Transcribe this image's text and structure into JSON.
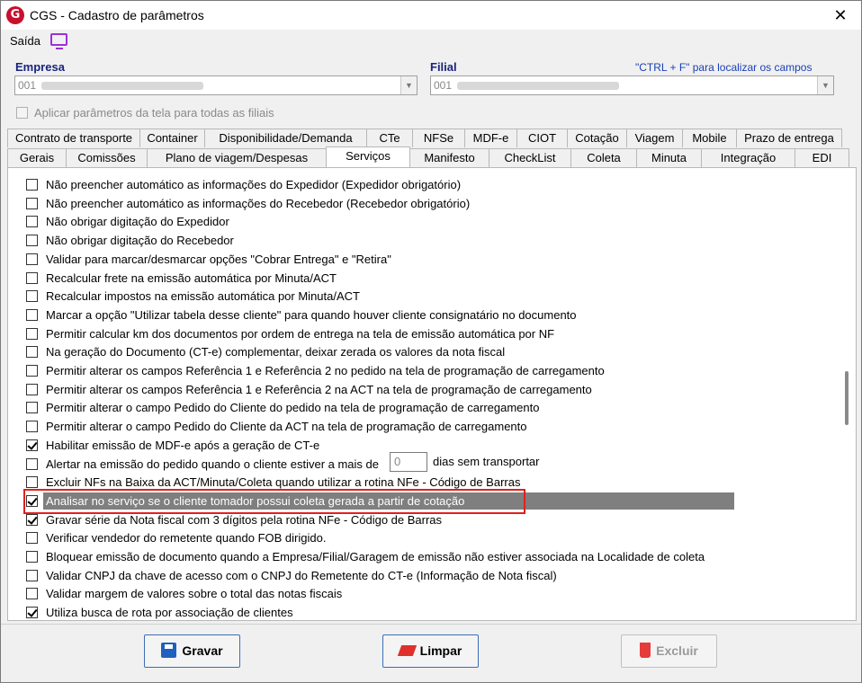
{
  "window": {
    "title": "CGS - Cadastro de parâmetros",
    "close_glyph": "✕"
  },
  "menu": {
    "exit_label": "Saída"
  },
  "empresa": {
    "label": "Empresa",
    "value": "001"
  },
  "filial": {
    "label": "Filial",
    "value": "001"
  },
  "hint": "\"CTRL + F\" para localizar os campos",
  "apply_all": {
    "label": "Aplicar parâmetros da tela para todas as filiais",
    "checked": false
  },
  "tabs_row1": [
    "Contrato de transporte",
    "Container",
    "Disponibilidade/Demanda",
    "CTe",
    "NFSe",
    "MDF-e",
    "CIOT",
    "Cotação",
    "Viagem",
    "Mobile",
    "Prazo de entrega"
  ],
  "tabs_row2": [
    "Gerais",
    "Comissões",
    "Plano de viagem/Despesas",
    "Serviços",
    "Manifesto",
    "CheckList",
    "Coleta",
    "Minuta",
    "Integração",
    "EDI"
  ],
  "active_tab": "Serviços",
  "options": [
    {
      "label": "Não preencher automático as informações do Expedidor (Expedidor obrigatório)",
      "checked": false
    },
    {
      "label": "Não preencher automático as informações do Recebedor (Recebedor obrigatório)",
      "checked": false
    },
    {
      "label": "Não obrigar digitação do Expedidor",
      "checked": false
    },
    {
      "label": "Não obrigar digitação do Recebedor",
      "checked": false
    },
    {
      "label": "Validar para marcar/desmarcar opções \"Cobrar Entrega\" e \"Retira\"",
      "checked": false
    },
    {
      "label": "Recalcular frete na emissão automática por Minuta/ACT",
      "checked": false
    },
    {
      "label": "Recalcular impostos na emissão automática por Minuta/ACT",
      "checked": false
    },
    {
      "label": "Marcar a opção \"Utilizar tabela desse cliente\" para quando houver cliente consignatário no documento",
      "checked": false
    },
    {
      "label": "Permitir calcular km dos documentos por ordem de entrega na tela de emissão automática por NF",
      "checked": false
    },
    {
      "label": "Na geração do Documento (CT-e) complementar, deixar zerada os valores da nota fiscal",
      "checked": false
    },
    {
      "label": "Permitir alterar os campos Referência 1 e Referência 2 no pedido na tela de programação de carregamento",
      "checked": false
    },
    {
      "label": "Permitir alterar os campos Referência 1 e Referência 2 na ACT na tela de programação de carregamento",
      "checked": false
    },
    {
      "label": "Permitir alterar o campo Pedido do Cliente do pedido na tela de programação de carregamento",
      "checked": false
    },
    {
      "label": "Permitir alterar o campo Pedido do Cliente da ACT na tela de programação de carregamento",
      "checked": false
    },
    {
      "label": "Habilitar emissão de MDF-e após a geração de CT-e",
      "checked": true
    },
    {
      "label": "Alertar na emissão do pedido quando o cliente estiver a mais de",
      "checked": false
    },
    {
      "label": "Excluir NFs na Baixa da ACT/Minuta/Coleta quando utilizar a rotina NFe - Código de Barras",
      "checked": false
    },
    {
      "label": "Analisar no serviço se o cliente tomador possui coleta gerada a partir de cotação",
      "checked": true
    },
    {
      "label": "Gravar série da Nota fiscal com 3 dígitos pela rotina NFe - Código de Barras",
      "checked": true
    },
    {
      "label": "Verificar vendedor do remetente quando FOB dirigido.",
      "checked": false
    },
    {
      "label": "Bloquear emissão de documento quando a Empresa/Filial/Garagem de emissão não estiver associada na Localidade de coleta",
      "checked": false
    },
    {
      "label": "Validar CNPJ da chave de acesso com o CNPJ do Remetente do CT-e (Informação de Nota fiscal)",
      "checked": false
    },
    {
      "label": "Validar margem de valores sobre o total das notas fiscais",
      "checked": false
    },
    {
      "label": "Utiliza busca de rota por associação de clientes",
      "checked": true
    }
  ],
  "days_field": {
    "value": "0",
    "suffix": "dias sem transportar"
  },
  "buttons": {
    "save": "Gravar",
    "clear": "Limpar",
    "delete": "Excluir"
  }
}
